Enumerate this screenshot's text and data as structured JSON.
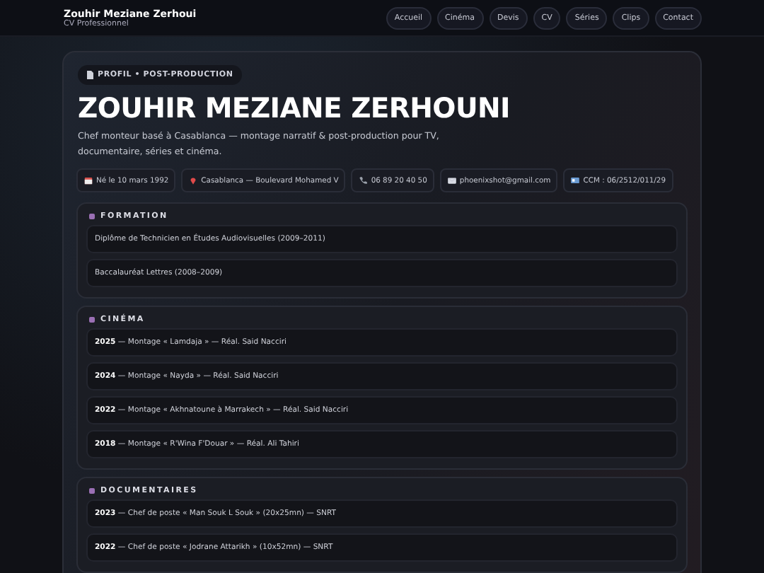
{
  "header": {
    "name": "Zouhir Meziane Zerhoui",
    "subtitle": "CV Professionnel",
    "nav": [
      {
        "label": "Accueil"
      },
      {
        "label": "Cinéma"
      },
      {
        "label": "Devis"
      },
      {
        "label": "CV"
      },
      {
        "label": "Séries"
      },
      {
        "label": "Clips"
      },
      {
        "label": "Contact"
      }
    ]
  },
  "hero": {
    "badge": "PROFIL • POST-PRODUCTION",
    "title": "ZOUHIR MEZIANE ZERHOUNI",
    "description": "Chef monteur basé à Casablanca — montage narratif & post-production pour TV, documentaire, séries et cinéma.",
    "chips": [
      {
        "kind": "calendar",
        "text": "Né le 10 mars 1992"
      },
      {
        "kind": "pin",
        "text": "Casablanca — Boulevard Mohamed V"
      },
      {
        "kind": "phone",
        "text": "06 89 20 40 50"
      },
      {
        "kind": "mail",
        "text": "phoenixshot@gmail.com"
      },
      {
        "kind": "card",
        "text": "CCM : 06/2512/011/29"
      }
    ]
  },
  "sections": [
    {
      "title": "FORMATION",
      "items": [
        "Diplôme de Technicien en Études Audiovisuelles (2009–2011)",
        "Baccalauréat Lettres (2008–2009)"
      ]
    },
    {
      "title": "CINÉMA",
      "items": [
        "**2025** — Montage « Lamdaja » — Réal. Said Nacciri",
        "**2024** — Montage « Nayda » — Réal. Said Nacciri",
        "**2022** — Montage « Akhnatoune à Marrakech » — Réal. Said Nacciri",
        "**2018** — Montage « R'Wina F'Douar » — Réal. Ali Tahiri"
      ]
    },
    {
      "title": "DOCUMENTAIRES",
      "items": [
        "**2023** — Chef de poste « Man Souk L Souk » (20x25mn) — SNRT",
        "**2022** — Chef de poste « Jodrane Attarikh » (10x52mn) — SNRT"
      ]
    }
  ]
}
